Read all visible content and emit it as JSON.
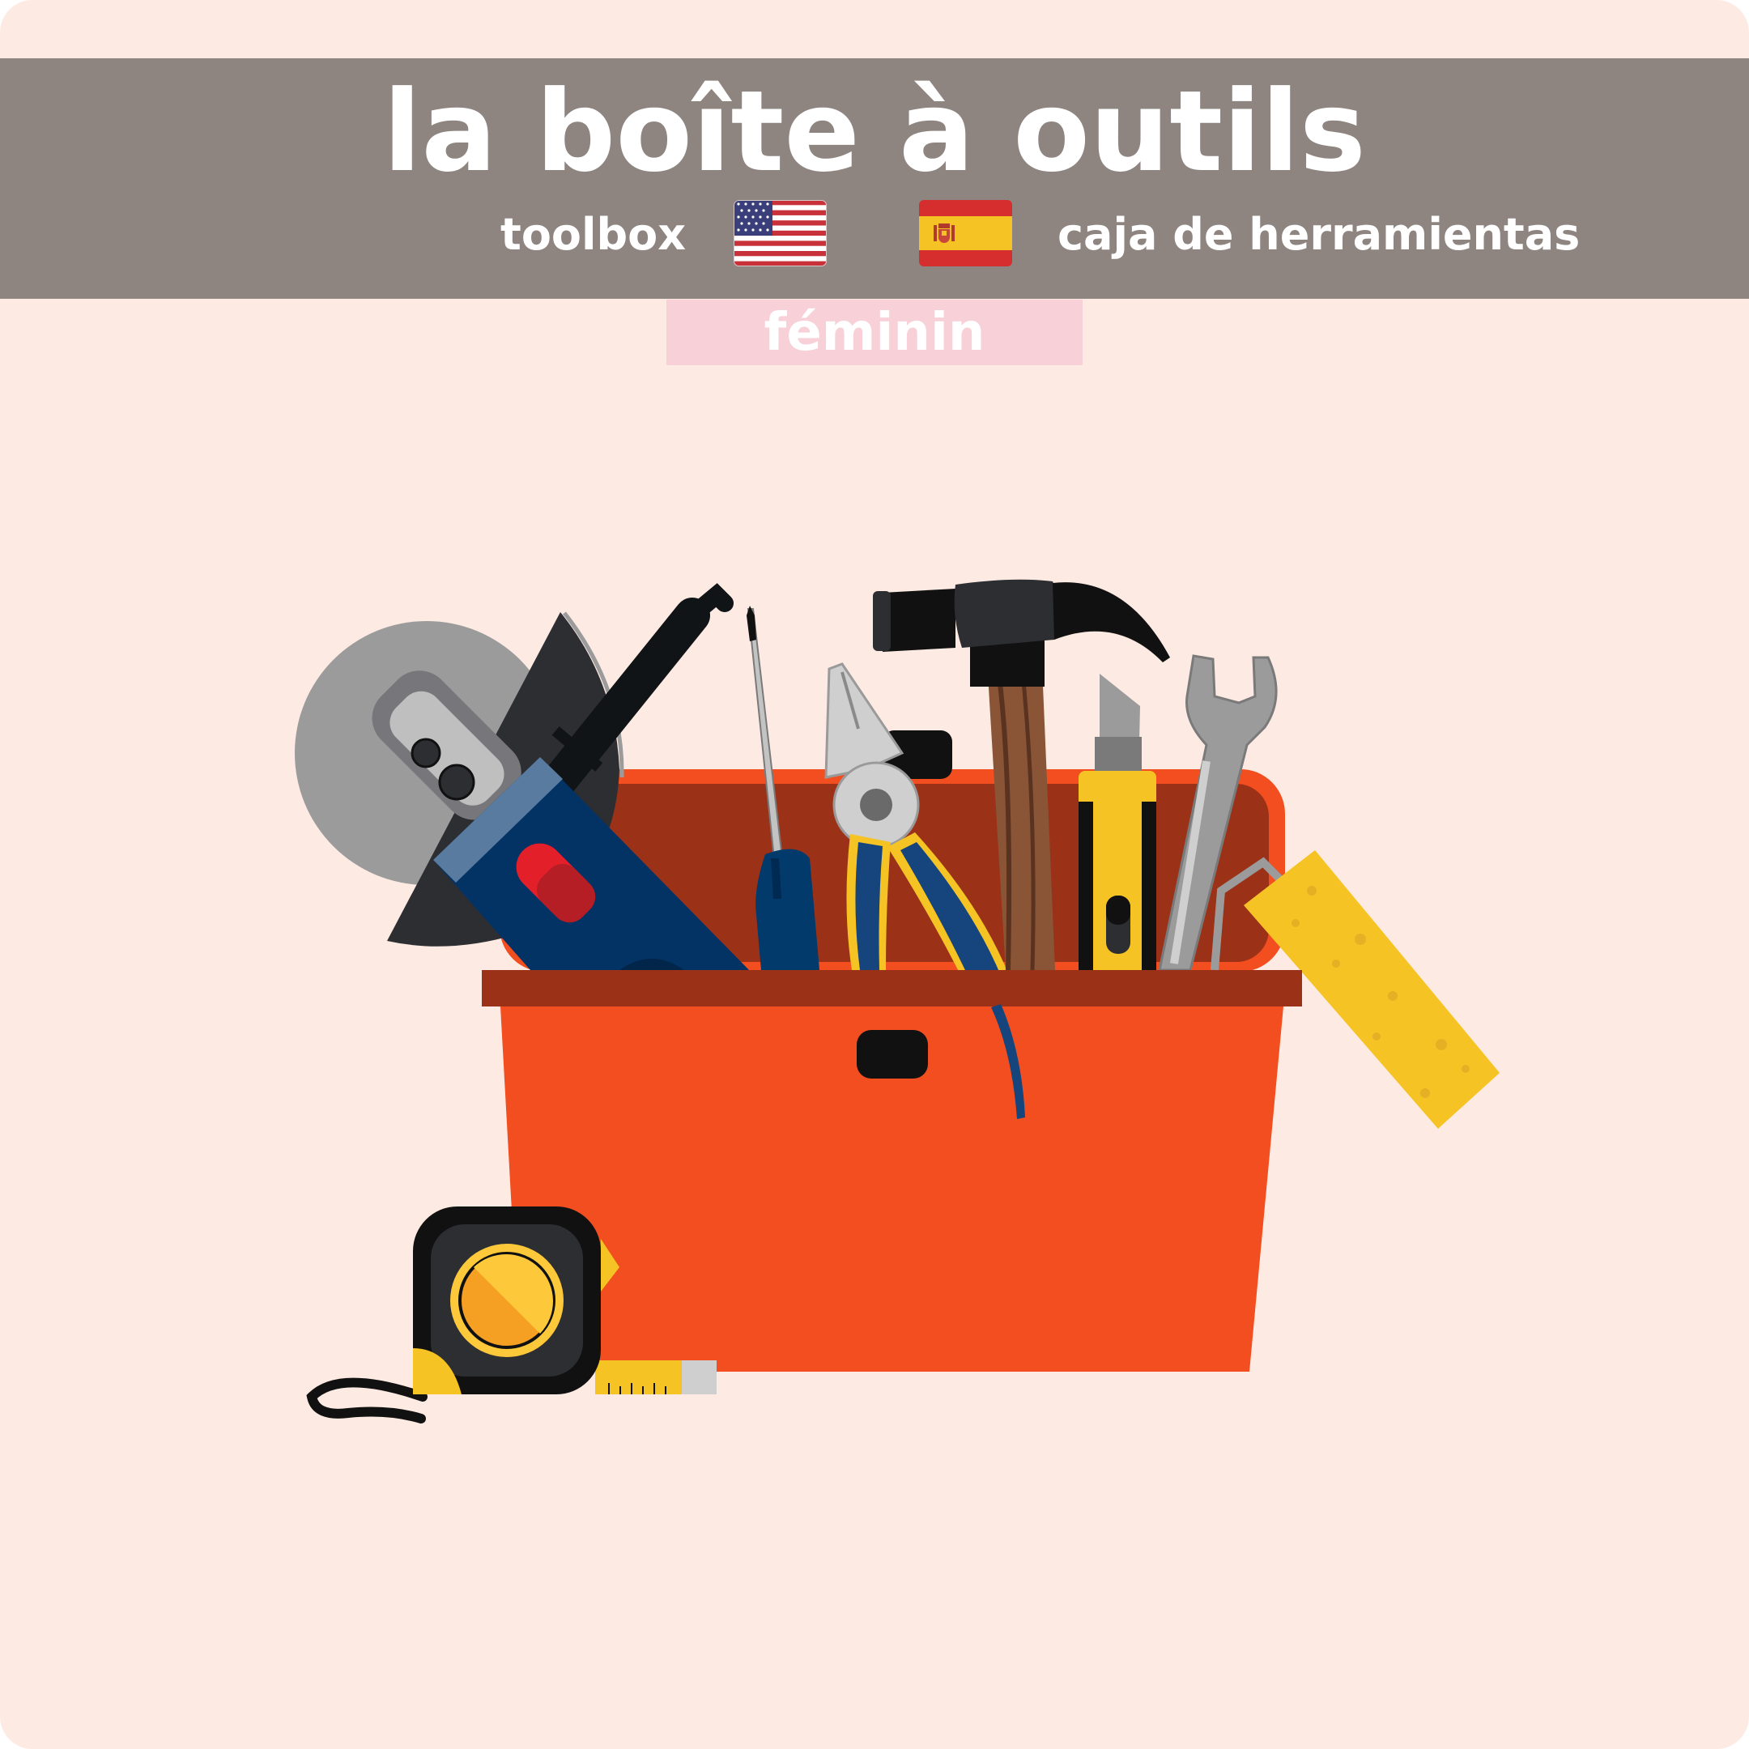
{
  "card": {
    "background": "#fdeae2",
    "banner_color": "#8e8480",
    "gender_color": "#f7d0d8"
  },
  "word": {
    "french": "la boîte à outils",
    "english": "toolbox",
    "spanish": "caja de herramientas",
    "gender": "féminin"
  },
  "flags": {
    "english": "us-flag-icon",
    "spanish": "spain-flag-icon"
  },
  "illustration": {
    "subject": "toolbox-illustration",
    "box_color": "#f24e1f",
    "rim_color": "#9b3218"
  }
}
